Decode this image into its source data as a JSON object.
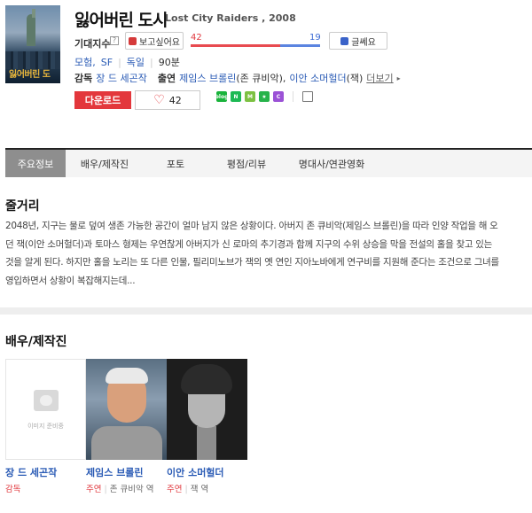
{
  "movie": {
    "title": "잃어버린 도시",
    "original_title": "Lost City Raiders , 2008",
    "poster_text": "잃어버린 도"
  },
  "expectation": {
    "label": "기대지수",
    "help": "?",
    "want_button": "보고싶어요",
    "meh_button": "글쎄요",
    "want_count": "42",
    "meh_count": "19",
    "want_ratio": 0.69
  },
  "meta": {
    "genres": [
      "모험",
      "SF"
    ],
    "country": "독일",
    "runtime": "90분"
  },
  "crew_line": {
    "director_label": "감독",
    "director": "장 드 세곤작",
    "cast_label": "출연",
    "cast1": "제임스 브롤린",
    "cast1_role": "(존 큐비악)",
    "cast2": "이안 소머헐더",
    "cast2_role": "(잭)",
    "more": "더보기",
    "more_arrow": "▸"
  },
  "actions": {
    "download": "다운로드",
    "likes": "42",
    "heart": "♡"
  },
  "share_icons": [
    {
      "name": "blog-share-icon",
      "text": "blog",
      "color": "#19b33b"
    },
    {
      "name": "naver-share-icon",
      "text": "N",
      "color": "#1db954"
    },
    {
      "name": "memo-share-icon",
      "text": "M",
      "color": "#7cc142"
    },
    {
      "name": "bookmark-share-icon",
      "text": "★",
      "color": "#27b34a"
    },
    {
      "name": "cafe-share-icon",
      "text": "C",
      "color": "#9b52d6"
    }
  ],
  "tabs": [
    "주요정보",
    "배우/제작진",
    "포토",
    "평점/리뷰",
    "명대사/연관영화"
  ],
  "synopsis": {
    "title": "줄거리",
    "text": "2048년, 지구는 물로 덮여 생존 가능한 공간이 얼마 남지 않은 상황이다. 아버지 존 큐비악(제임스 브롤린)을 따라 인양 작업을 해 오던 잭(이안 소머헐더)과 토마스 형제는 우연찮게 아버지가 신 로마의 추기경과 함께 지구의 수위 상승을 막을 전설의 홀을 찾고 있는 것을 알게 된다. 하지만 홀을 노리는 또 다른 인물, 필리미노브가 잭의 옛 연인 지아노바에게 연구비를 지원해 준다는 조건으로 그녀를 영입하면서 상황이 복잡해지는데..."
  },
  "cast_section": {
    "title": "배우/제작진",
    "no_image_text": "이미지 준비중",
    "people": [
      {
        "name": "장 드 세곤작",
        "role": "감독",
        "character": ""
      },
      {
        "name": "제임스 브롤린",
        "role": "주연",
        "character": "존 큐비악 역"
      },
      {
        "name": "이안 소머헐더",
        "role": "주연",
        "character": "잭 역"
      }
    ]
  }
}
